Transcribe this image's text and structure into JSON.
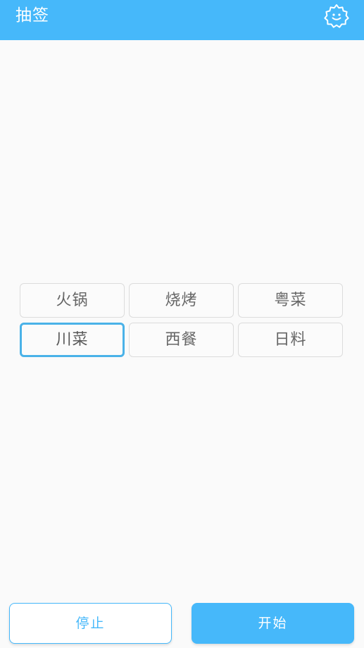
{
  "header": {
    "title": "抽签",
    "settings_icon": "gear-smile-icon",
    "bg_color": "#46b8fa"
  },
  "options": [
    {
      "label": "火锅",
      "selected": false
    },
    {
      "label": "烧烤",
      "selected": false
    },
    {
      "label": "粤菜",
      "selected": false
    },
    {
      "label": "川菜",
      "selected": true
    },
    {
      "label": "西餐",
      "selected": false
    },
    {
      "label": "日料",
      "selected": false
    }
  ],
  "actions": {
    "stop_label": "停止",
    "start_label": "开始"
  },
  "colors": {
    "accent": "#46b8fa",
    "selected_border": "#4ab2e8",
    "text": "#666666"
  }
}
